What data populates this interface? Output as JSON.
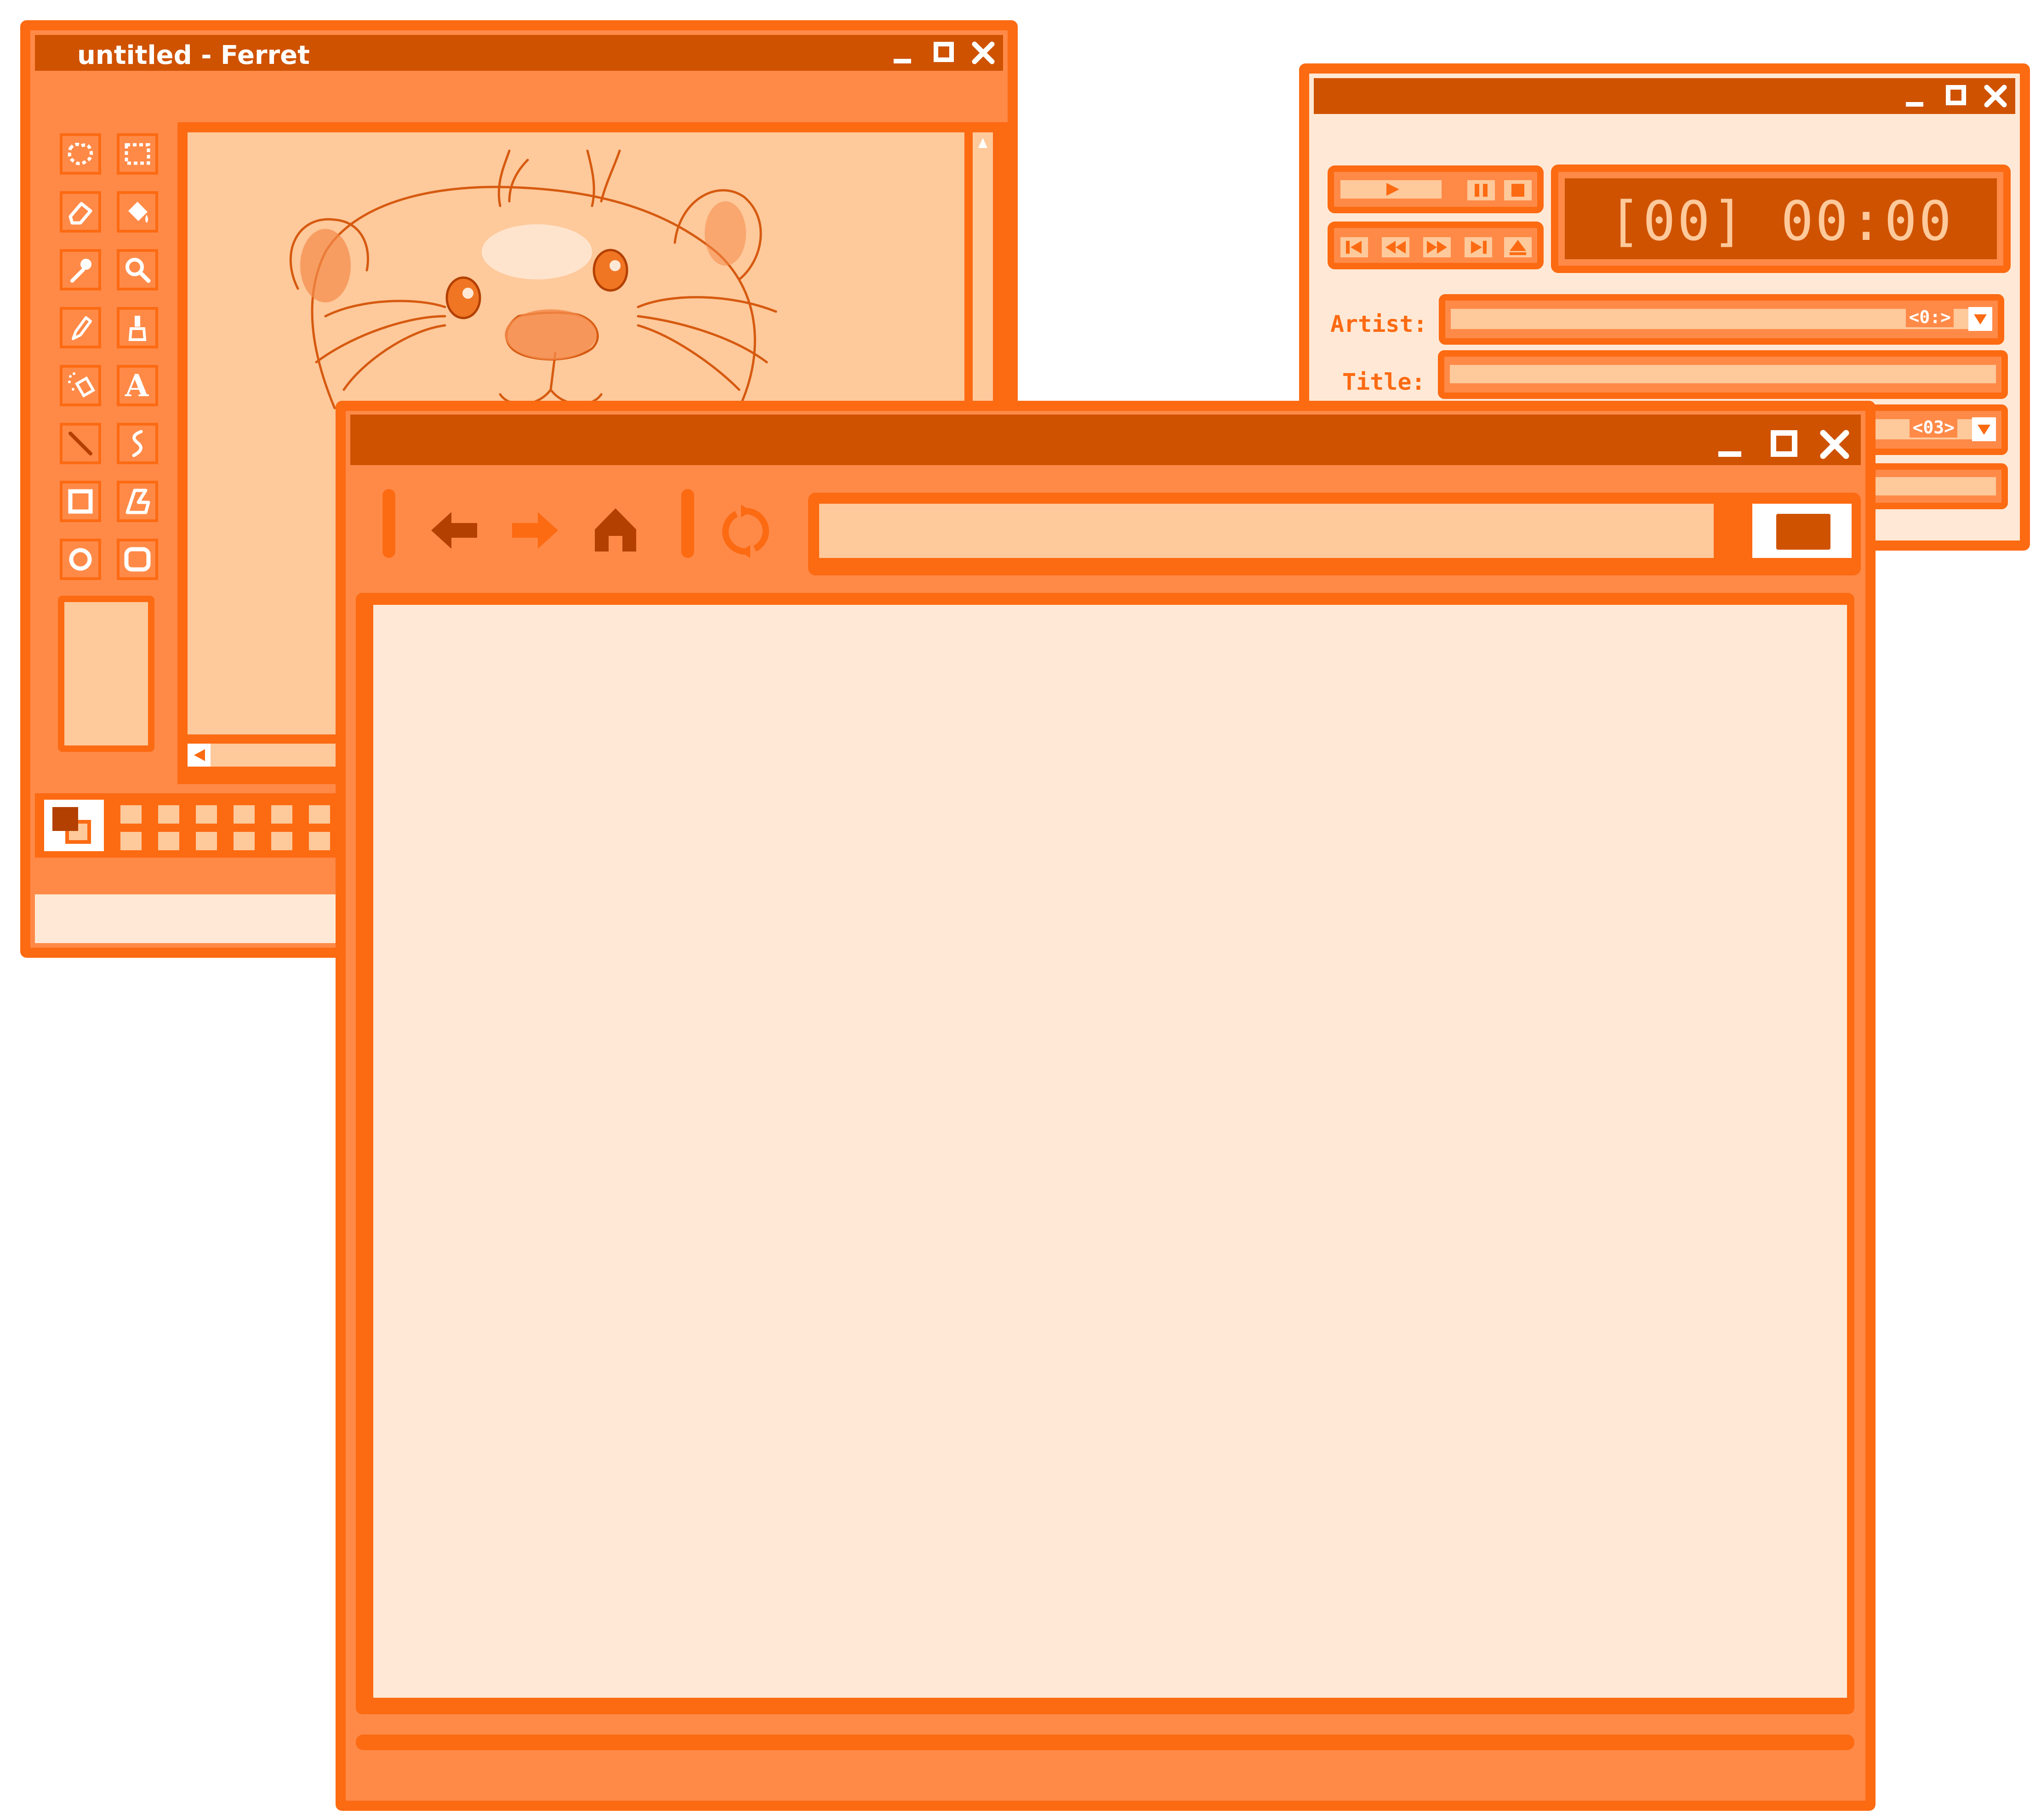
{
  "colors": {
    "border": "#fc6a12",
    "chrome": "#ff8a48",
    "titlebar": "#cf5200",
    "peach": "#fec99b",
    "pale": "#ffe9d6",
    "white": "#ffffff"
  },
  "paint_window": {
    "title": "untitled - Ferret",
    "tools": [
      "free-select-icon",
      "rect-select-icon",
      "eraser-icon",
      "fill-bucket-icon",
      "eyedropper-icon",
      "magnifier-icon",
      "pencil-icon",
      "brush-icon",
      "airbrush-icon",
      "text-icon",
      "line-icon",
      "curve-icon",
      "rectangle-icon",
      "polygon-icon",
      "ellipse-icon",
      "rounded-rect-icon"
    ],
    "text_tool_glyph": "A"
  },
  "media_window": {
    "display": "[00] 00:00",
    "artist_label": "Artist:",
    "title_label": "Title:",
    "artist_counter": "<0:>",
    "third_counter": "<03>"
  },
  "browser_window": {
    "address_value": ""
  }
}
